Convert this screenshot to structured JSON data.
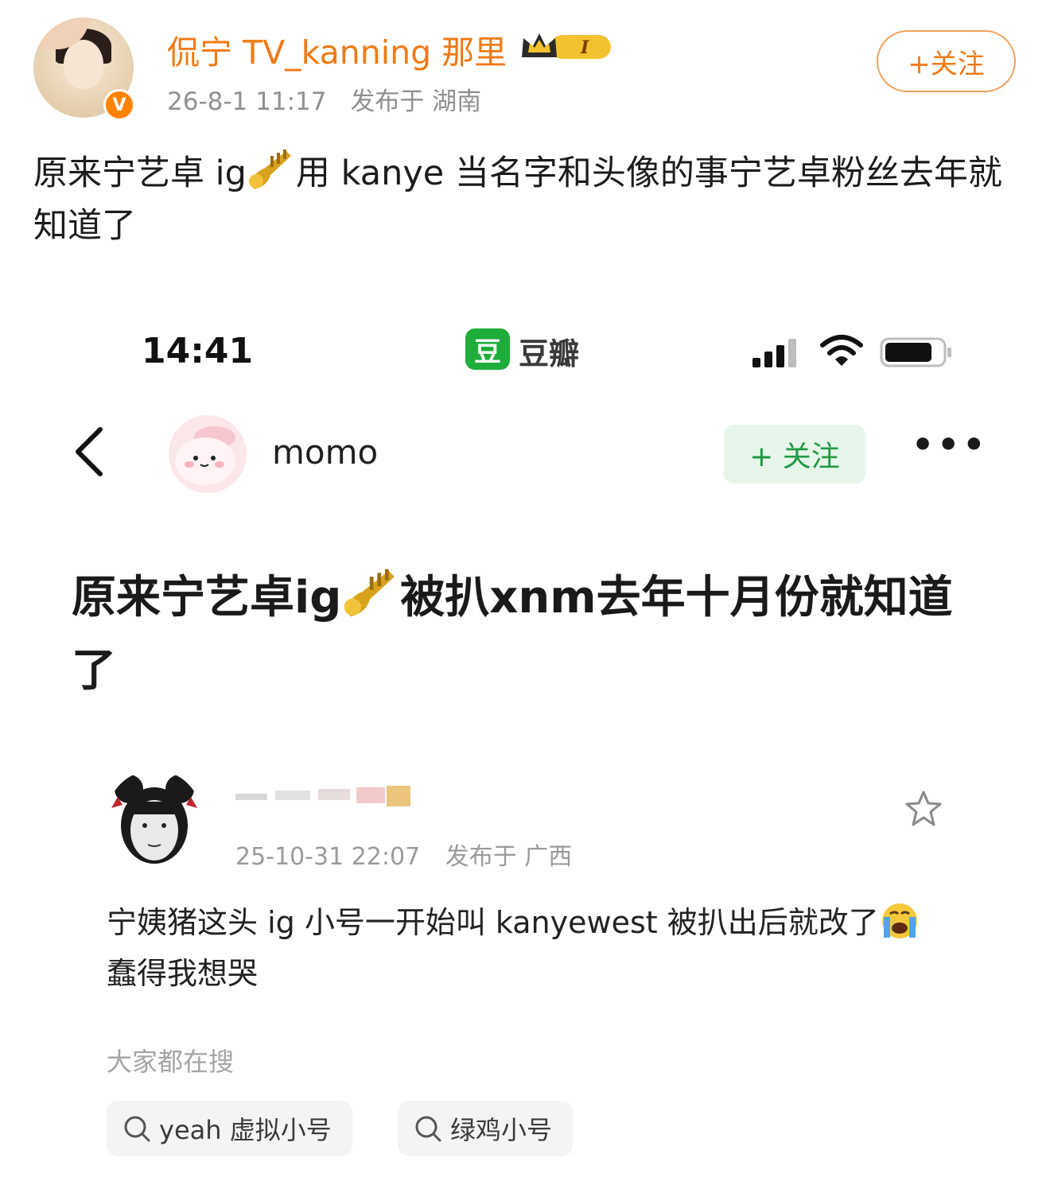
{
  "weibo": {
    "author": "侃宁 TV_kanning 那里",
    "level_badge": "I",
    "time": "26-8-1 11:17",
    "location": "发布于 湖南",
    "follow_label": "+关注",
    "verified_badge": "V",
    "text_before": "原来宁艺卓 ig",
    "text_after": "用 kanye 当名字和头像的事宁艺卓粉丝去年就知道了",
    "icons": [
      "trumpet-emoji",
      "crown-icon",
      "verified-icon"
    ]
  },
  "screenshot": {
    "status_bar": {
      "time": "14:41",
      "app_logo": "豆",
      "app_name": "豆瓣"
    },
    "nav": {
      "username": "momo",
      "follow_label": "+ 关注",
      "more_label": "•••"
    },
    "post_title_before": "原来宁艺卓ig",
    "post_title_after": "被扒xnm去年十月份就知道了",
    "comment": {
      "time": "25-10-31 22:07",
      "location": "发布于 广西",
      "text_before": "宁姨猪这头 ig 小号一开始叫 kanyewest 被扒出后就改了",
      "text_after": "蠢得我想哭"
    },
    "hot_search_title": "大家都在搜",
    "hot_searches": [
      "yeah 虚拟小号",
      "绿鸡小号"
    ]
  },
  "colors": {
    "weibo_orange": "#f07a15",
    "douban_green": "#1ead3b",
    "meta_gray": "#909090"
  }
}
